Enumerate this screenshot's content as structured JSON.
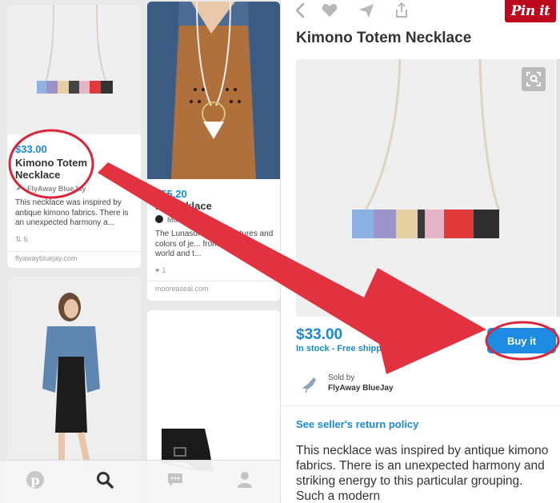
{
  "left_feed": {
    "card1": {
      "price": "$33.00",
      "title": "Kimono Totem Necklace",
      "seller": "FlyAway BlueJay",
      "description": "This necklace was inspired by antique kimono fabrics. There is an unexpected harmony a...",
      "repins": "6",
      "domain": "flyawaybluejay.com"
    },
    "card2": {
      "price": "$55.20",
      "title": "... Necklace",
      "seller": "Moore...",
      "description": "The Lunasol line c... textures and colors of je... from around the world and t...",
      "likes": "1",
      "domain": "mooreaseal.com"
    }
  },
  "bottom_nav": {
    "items": [
      "home",
      "search",
      "messages",
      "profile"
    ]
  },
  "detail": {
    "title": "Kimono Totem Necklace",
    "pin_button": "Pin it",
    "price": "$33.00",
    "stock": "In stock - Free shipping",
    "buy_button": "Buy it",
    "sold_by_label": "Sold by",
    "seller_name": "FlyAway BlueJay",
    "return_policy": "See seller's return policy",
    "description": "This necklace was inspired by antique kimono fabrics. There is an unexpected harmony and striking energy to this particular grouping. Such a modern"
  },
  "colors": {
    "pinterest_red": "#bd081c",
    "price_blue": "#1a8ad6",
    "buy_blue": "#1c8be1",
    "annotation_red": "#d9263a"
  }
}
